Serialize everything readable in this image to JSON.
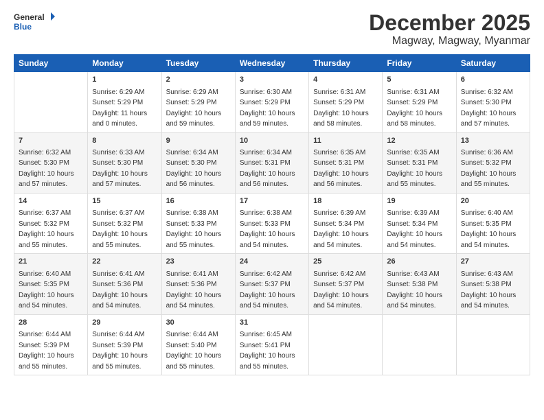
{
  "header": {
    "logo_line1": "General",
    "logo_line2": "Blue",
    "title": "December 2025",
    "subtitle": "Magway, Magway, Myanmar"
  },
  "calendar": {
    "days_of_week": [
      "Sunday",
      "Monday",
      "Tuesday",
      "Wednesday",
      "Thursday",
      "Friday",
      "Saturday"
    ],
    "weeks": [
      [
        {
          "day": "",
          "sunrise": "",
          "sunset": "",
          "daylight": ""
        },
        {
          "day": "1",
          "sunrise": "Sunrise: 6:29 AM",
          "sunset": "Sunset: 5:29 PM",
          "daylight": "Daylight: 11 hours and 0 minutes."
        },
        {
          "day": "2",
          "sunrise": "Sunrise: 6:29 AM",
          "sunset": "Sunset: 5:29 PM",
          "daylight": "Daylight: 10 hours and 59 minutes."
        },
        {
          "day": "3",
          "sunrise": "Sunrise: 6:30 AM",
          "sunset": "Sunset: 5:29 PM",
          "daylight": "Daylight: 10 hours and 59 minutes."
        },
        {
          "day": "4",
          "sunrise": "Sunrise: 6:31 AM",
          "sunset": "Sunset: 5:29 PM",
          "daylight": "Daylight: 10 hours and 58 minutes."
        },
        {
          "day": "5",
          "sunrise": "Sunrise: 6:31 AM",
          "sunset": "Sunset: 5:29 PM",
          "daylight": "Daylight: 10 hours and 58 minutes."
        },
        {
          "day": "6",
          "sunrise": "Sunrise: 6:32 AM",
          "sunset": "Sunset: 5:30 PM",
          "daylight": "Daylight: 10 hours and 57 minutes."
        }
      ],
      [
        {
          "day": "7",
          "sunrise": "Sunrise: 6:32 AM",
          "sunset": "Sunset: 5:30 PM",
          "daylight": "Daylight: 10 hours and 57 minutes."
        },
        {
          "day": "8",
          "sunrise": "Sunrise: 6:33 AM",
          "sunset": "Sunset: 5:30 PM",
          "daylight": "Daylight: 10 hours and 57 minutes."
        },
        {
          "day": "9",
          "sunrise": "Sunrise: 6:34 AM",
          "sunset": "Sunset: 5:30 PM",
          "daylight": "Daylight: 10 hours and 56 minutes."
        },
        {
          "day": "10",
          "sunrise": "Sunrise: 6:34 AM",
          "sunset": "Sunset: 5:31 PM",
          "daylight": "Daylight: 10 hours and 56 minutes."
        },
        {
          "day": "11",
          "sunrise": "Sunrise: 6:35 AM",
          "sunset": "Sunset: 5:31 PM",
          "daylight": "Daylight: 10 hours and 56 minutes."
        },
        {
          "day": "12",
          "sunrise": "Sunrise: 6:35 AM",
          "sunset": "Sunset: 5:31 PM",
          "daylight": "Daylight: 10 hours and 55 minutes."
        },
        {
          "day": "13",
          "sunrise": "Sunrise: 6:36 AM",
          "sunset": "Sunset: 5:32 PM",
          "daylight": "Daylight: 10 hours and 55 minutes."
        }
      ],
      [
        {
          "day": "14",
          "sunrise": "Sunrise: 6:37 AM",
          "sunset": "Sunset: 5:32 PM",
          "daylight": "Daylight: 10 hours and 55 minutes."
        },
        {
          "day": "15",
          "sunrise": "Sunrise: 6:37 AM",
          "sunset": "Sunset: 5:32 PM",
          "daylight": "Daylight: 10 hours and 55 minutes."
        },
        {
          "day": "16",
          "sunrise": "Sunrise: 6:38 AM",
          "sunset": "Sunset: 5:33 PM",
          "daylight": "Daylight: 10 hours and 55 minutes."
        },
        {
          "day": "17",
          "sunrise": "Sunrise: 6:38 AM",
          "sunset": "Sunset: 5:33 PM",
          "daylight": "Daylight: 10 hours and 54 minutes."
        },
        {
          "day": "18",
          "sunrise": "Sunrise: 6:39 AM",
          "sunset": "Sunset: 5:34 PM",
          "daylight": "Daylight: 10 hours and 54 minutes."
        },
        {
          "day": "19",
          "sunrise": "Sunrise: 6:39 AM",
          "sunset": "Sunset: 5:34 PM",
          "daylight": "Daylight: 10 hours and 54 minutes."
        },
        {
          "day": "20",
          "sunrise": "Sunrise: 6:40 AM",
          "sunset": "Sunset: 5:35 PM",
          "daylight": "Daylight: 10 hours and 54 minutes."
        }
      ],
      [
        {
          "day": "21",
          "sunrise": "Sunrise: 6:40 AM",
          "sunset": "Sunset: 5:35 PM",
          "daylight": "Daylight: 10 hours and 54 minutes."
        },
        {
          "day": "22",
          "sunrise": "Sunrise: 6:41 AM",
          "sunset": "Sunset: 5:36 PM",
          "daylight": "Daylight: 10 hours and 54 minutes."
        },
        {
          "day": "23",
          "sunrise": "Sunrise: 6:41 AM",
          "sunset": "Sunset: 5:36 PM",
          "daylight": "Daylight: 10 hours and 54 minutes."
        },
        {
          "day": "24",
          "sunrise": "Sunrise: 6:42 AM",
          "sunset": "Sunset: 5:37 PM",
          "daylight": "Daylight: 10 hours and 54 minutes."
        },
        {
          "day": "25",
          "sunrise": "Sunrise: 6:42 AM",
          "sunset": "Sunset: 5:37 PM",
          "daylight": "Daylight: 10 hours and 54 minutes."
        },
        {
          "day": "26",
          "sunrise": "Sunrise: 6:43 AM",
          "sunset": "Sunset: 5:38 PM",
          "daylight": "Daylight: 10 hours and 54 minutes."
        },
        {
          "day": "27",
          "sunrise": "Sunrise: 6:43 AM",
          "sunset": "Sunset: 5:38 PM",
          "daylight": "Daylight: 10 hours and 54 minutes."
        }
      ],
      [
        {
          "day": "28",
          "sunrise": "Sunrise: 6:44 AM",
          "sunset": "Sunset: 5:39 PM",
          "daylight": "Daylight: 10 hours and 55 minutes."
        },
        {
          "day": "29",
          "sunrise": "Sunrise: 6:44 AM",
          "sunset": "Sunset: 5:39 PM",
          "daylight": "Daylight: 10 hours and 55 minutes."
        },
        {
          "day": "30",
          "sunrise": "Sunrise: 6:44 AM",
          "sunset": "Sunset: 5:40 PM",
          "daylight": "Daylight: 10 hours and 55 minutes."
        },
        {
          "day": "31",
          "sunrise": "Sunrise: 6:45 AM",
          "sunset": "Sunset: 5:41 PM",
          "daylight": "Daylight: 10 hours and 55 minutes."
        },
        {
          "day": "",
          "sunrise": "",
          "sunset": "",
          "daylight": ""
        },
        {
          "day": "",
          "sunrise": "",
          "sunset": "",
          "daylight": ""
        },
        {
          "day": "",
          "sunrise": "",
          "sunset": "",
          "daylight": ""
        }
      ]
    ]
  }
}
